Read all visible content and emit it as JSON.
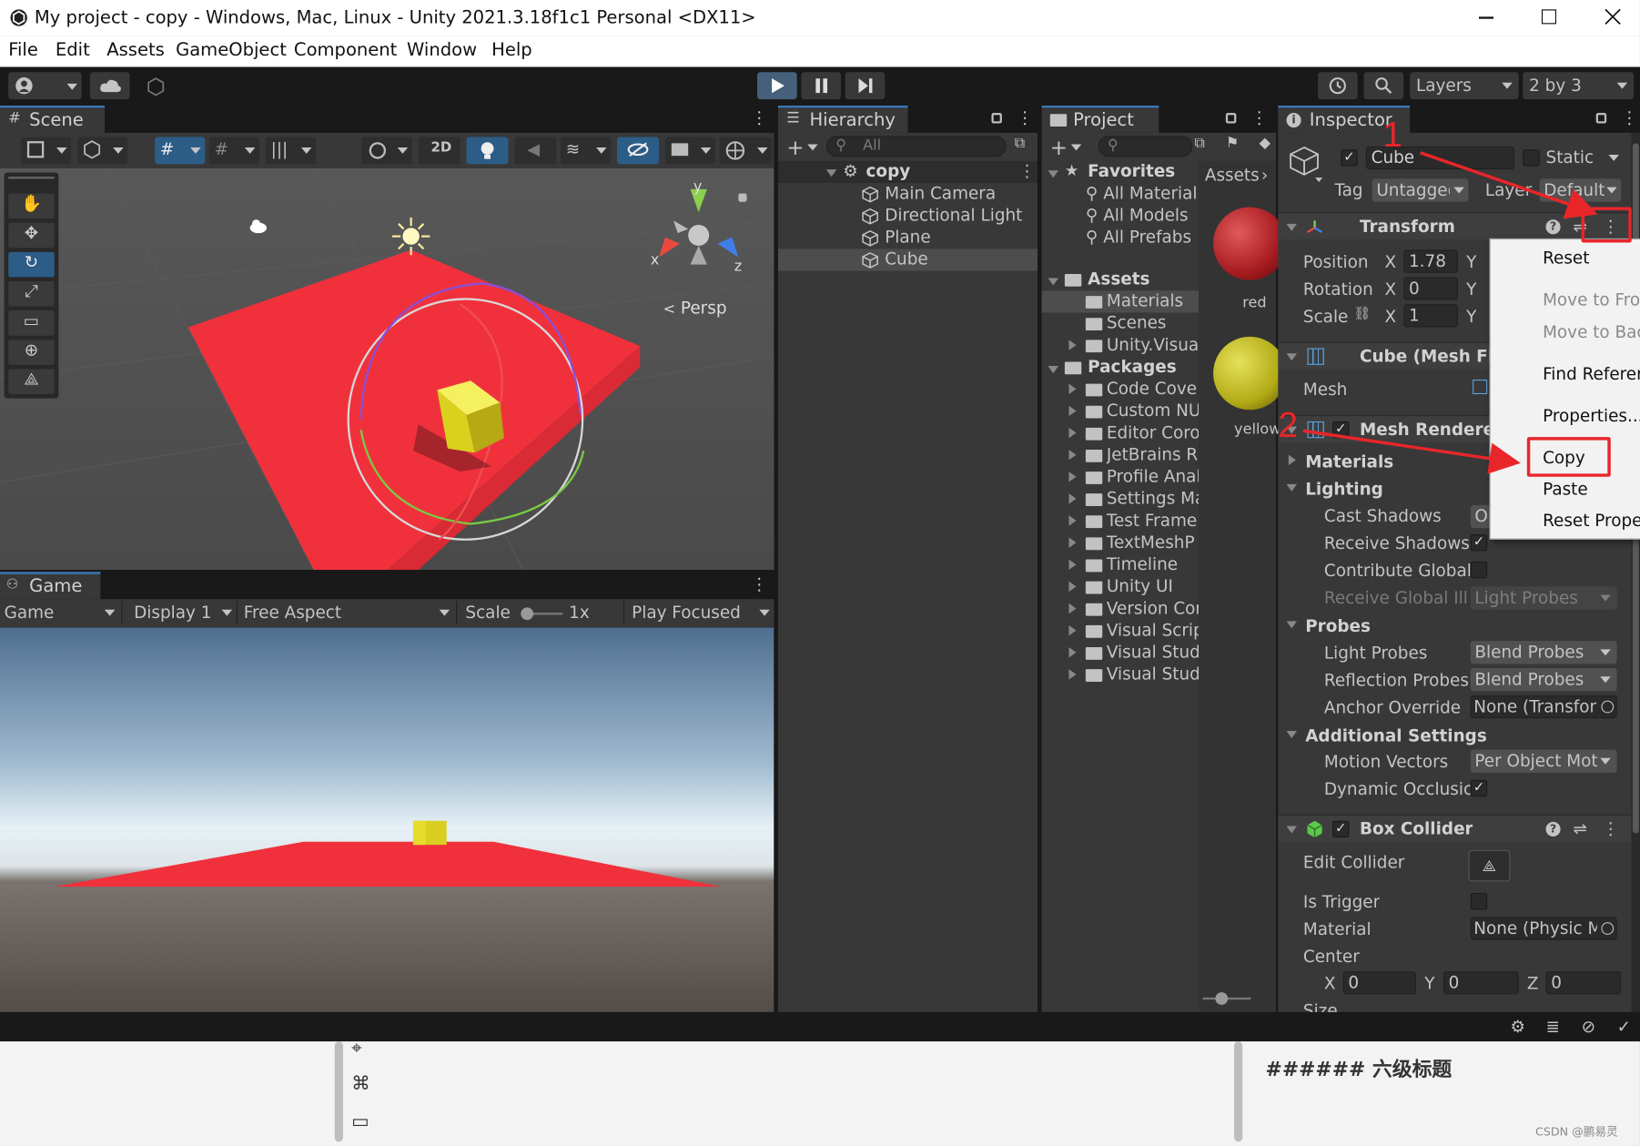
{
  "window": {
    "title": "My project - copy - Windows, Mac, Linux - Unity 2021.3.18f1c1 Personal <DX11>"
  },
  "menu": [
    "File",
    "Edit",
    "Assets",
    "GameObject",
    "Component",
    "Window",
    "Help"
  ],
  "toolbar": {
    "layers": "Layers",
    "layout": "2 by 3"
  },
  "scene": {
    "tab": "Scene",
    "btn2d": "2D",
    "persp": "Persp",
    "axis_x": "x",
    "axis_y": "y",
    "axis_z": "z"
  },
  "game": {
    "tab": "Game",
    "view": "Game",
    "display": "Display 1",
    "aspect": "Free Aspect",
    "scale_label": "Scale",
    "scale_value": "1x",
    "play_mode": "Play Focused"
  },
  "hierarchy": {
    "tab": "Hierarchy",
    "search": "All",
    "scene": "copy",
    "items": [
      "Main Camera",
      "Directional Light",
      "Plane",
      "Cube"
    ]
  },
  "project": {
    "tab": "Project",
    "favorites": "Favorites",
    "fav_items": [
      "All Material",
      "All Models",
      "All Prefabs"
    ],
    "assets": "Assets",
    "asset_items": [
      "Materials",
      "Scenes",
      "Unity.Visua"
    ],
    "packages": "Packages",
    "package_items": [
      "Code Cove",
      "Custom NU",
      "Editor Coro",
      "JetBrains R",
      "Profile Anal",
      "Settings Ma",
      "Test Frame",
      "TextMeshP",
      "Timeline",
      "Unity UI",
      "Version Cor",
      "Visual Scrip",
      "Visual Stud",
      "Visual Stud"
    ],
    "breadcrumb": "Assets",
    "materials": [
      "red",
      "yellow"
    ]
  },
  "inspector": {
    "tab": "Inspector",
    "object_name": "Cube",
    "static": "Static",
    "tag_label": "Tag",
    "tag": "Untagged",
    "layer_label": "Layer",
    "layer": "Default",
    "transform": {
      "title": "Transform",
      "position": "Position",
      "rotation": "Rotation",
      "scale": "Scale",
      "x": "X",
      "y": "Y",
      "pos_x": "1.78",
      "rot_x": "0",
      "scale_x": "1"
    },
    "mesh_filter": {
      "title": "Cube (Mesh Filt",
      "mesh": "Mesh"
    },
    "mesh_renderer": {
      "title": "Mesh Renderer",
      "materials": "Materials",
      "lighting": "Lighting",
      "cast_shadows": "Cast Shadows",
      "cast_shadows_value": "Or",
      "receive_shadows": "Receive Shadows",
      "contribute_gi": "Contribute Global",
      "receive_gi": "Receive Global Ill",
      "receive_gi_value": "Light Probes",
      "probes": "Probes",
      "light_probes": "Light Probes",
      "light_probes_value": "Blend Probes",
      "reflection_probes": "Reflection Probes",
      "reflection_probes_value": "Blend Probes",
      "anchor_override": "Anchor Override",
      "anchor_override_value": "None (Transforr",
      "additional": "Additional Settings",
      "motion_vectors": "Motion Vectors",
      "motion_vectors_value": "Per Object Moti",
      "dynamic_occlusion": "Dynamic Occlusic"
    },
    "box_collider": {
      "title": "Box Collider",
      "edit_collider": "Edit Collider",
      "is_trigger": "Is Trigger",
      "material": "Material",
      "material_value": "None (Physic M",
      "center": "Center",
      "x": "X",
      "y": "Y",
      "z": "Z",
      "cx": "0",
      "cy": "0",
      "cz": "0",
      "size": "Size"
    }
  },
  "context_menu": {
    "items": [
      "Reset",
      "Move to Fror",
      "Move to Bac",
      "Find Referen",
      "Properties...",
      "Copy",
      "Paste",
      "Reset Proper"
    ]
  },
  "annotations": {
    "one": "1",
    "two": "2"
  },
  "background": {
    "heading": "###### 六级标题",
    "watermark": "CSDN @鹏易灵"
  },
  "colors": {
    "panel": "#383838",
    "dark": "#191919",
    "accent": "#3a79bb",
    "annotation": "#e8262a",
    "plane": "#f0313c",
    "cube": "#e8e030"
  }
}
